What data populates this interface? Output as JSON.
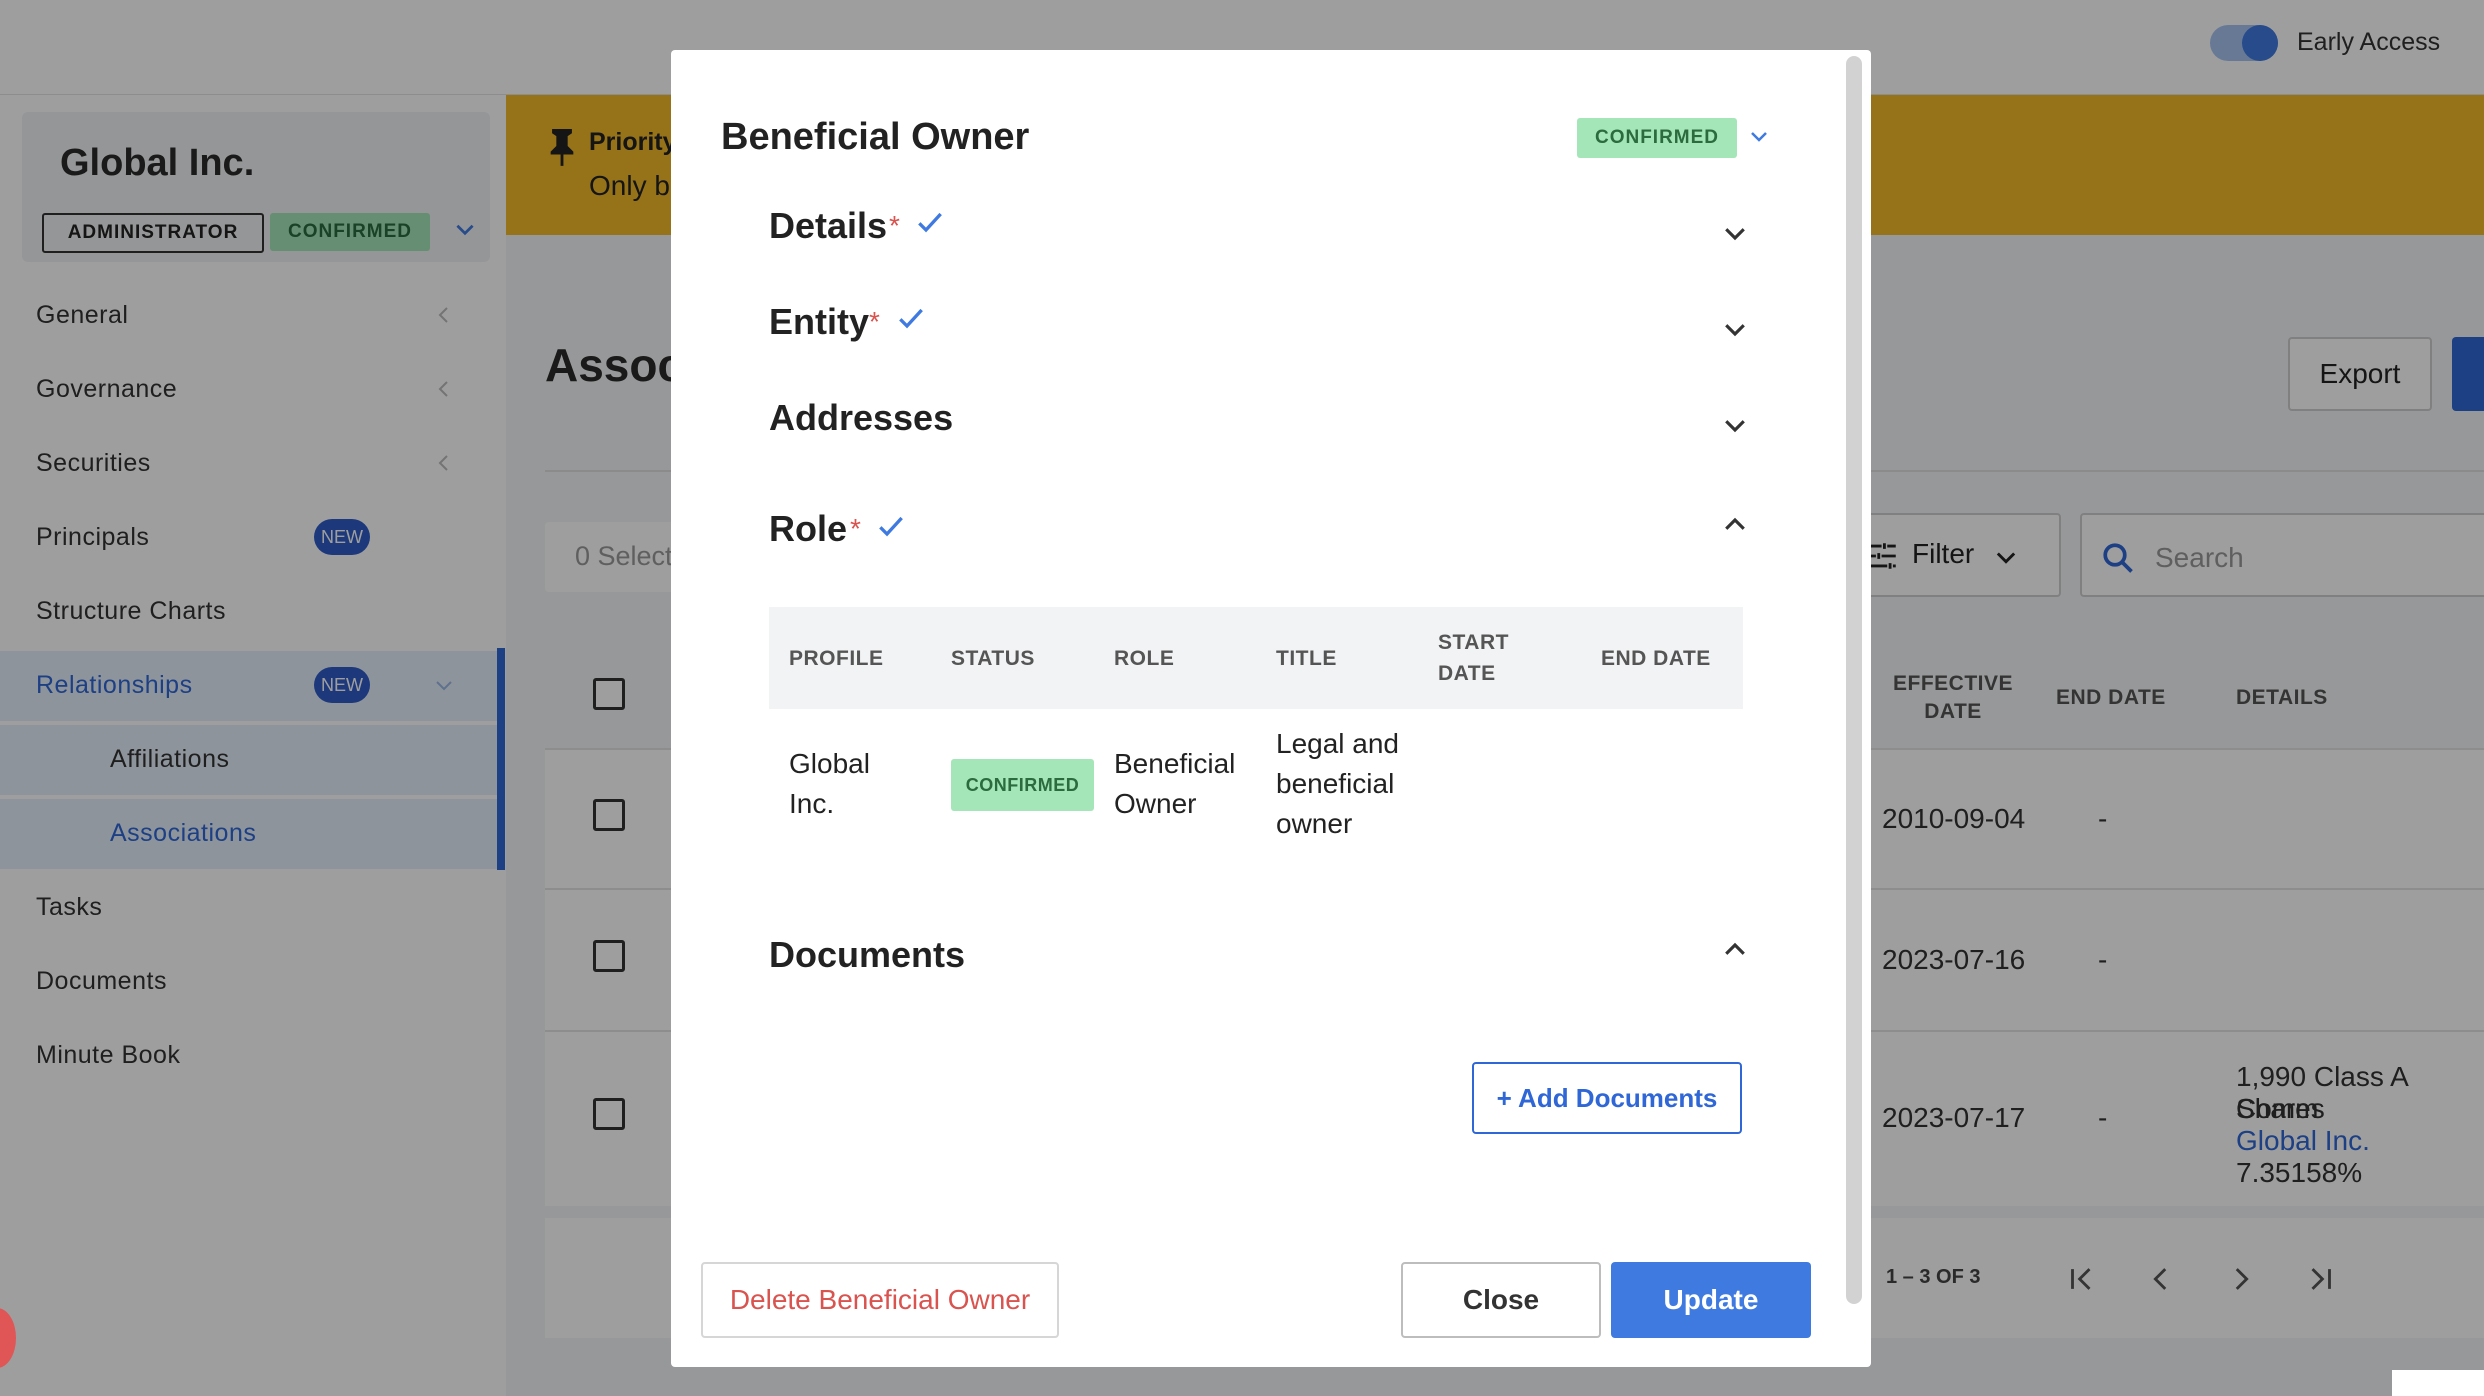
{
  "topbar": {
    "early_access_label": "Early Access",
    "early_access_on": true
  },
  "company": {
    "name": "Global Inc.",
    "role_badge": "ADMINISTRATOR",
    "status_badge": "CONFIRMED"
  },
  "sidebar": {
    "items": [
      {
        "label": "General"
      },
      {
        "label": "Governance"
      },
      {
        "label": "Securities"
      },
      {
        "label": "Principals",
        "badge": "NEW"
      },
      {
        "label": "Structure Charts"
      },
      {
        "label": "Relationships",
        "badge": "NEW"
      },
      {
        "label": "Affiliations"
      },
      {
        "label": "Associations"
      },
      {
        "label": "Tasks"
      },
      {
        "label": "Documents"
      },
      {
        "label": "Minute Book"
      }
    ]
  },
  "banner": {
    "title": "Priority",
    "text": "Only b"
  },
  "page": {
    "title": "Assoc",
    "export_label": "Export",
    "selected_text": "0 Select",
    "filter_label": "Filter",
    "search_placeholder": "Search"
  },
  "table": {
    "headers": {
      "effective_date": "EFFECTIVE DATE",
      "end_date": "END DATE",
      "details": "DETAILS"
    },
    "rows": [
      {
        "effective_date": "2010-09-04",
        "end_date": "-"
      },
      {
        "effective_date": "2023-07-16",
        "end_date": "-"
      },
      {
        "effective_date": "2023-07-17",
        "end_date": "-",
        "details_line1": "1,990 Class A Comm",
        "details_line2": "Shares",
        "details_link": "Global Inc.",
        "details_line4": "7.35158%"
      }
    ],
    "pager": "1 – 3 OF 3"
  },
  "modal": {
    "title": "Beneficial Owner",
    "status": "CONFIRMED",
    "sections": {
      "details": "Details",
      "entity": "Entity",
      "addresses": "Addresses",
      "role": "Role",
      "documents": "Documents"
    },
    "required_mark": "*",
    "role_table": {
      "headers": {
        "profile": "PROFILE",
        "status": "STATUS",
        "role": "ROLE",
        "title": "TITLE",
        "start_date_1": "START",
        "start_date_2": "DATE",
        "end_date": "END DATE"
      },
      "row": {
        "profile_1": "Global",
        "profile_2": "Inc.",
        "status": "CONFIRMED",
        "role_1": "Beneficial",
        "role_2": "Owner",
        "title_1": "Legal and",
        "title_2": "beneficial",
        "title_3": "owner"
      }
    },
    "add_documents_label": "+ Add Documents",
    "delete_label": "Delete Beneficial Owner",
    "close_label": "Close",
    "update_label": "Update"
  },
  "colors": {
    "accent": "#3f7ae0",
    "confirmed_bg": "#a5e6b8",
    "banner": "#f2b929",
    "danger": "#d9534f"
  }
}
